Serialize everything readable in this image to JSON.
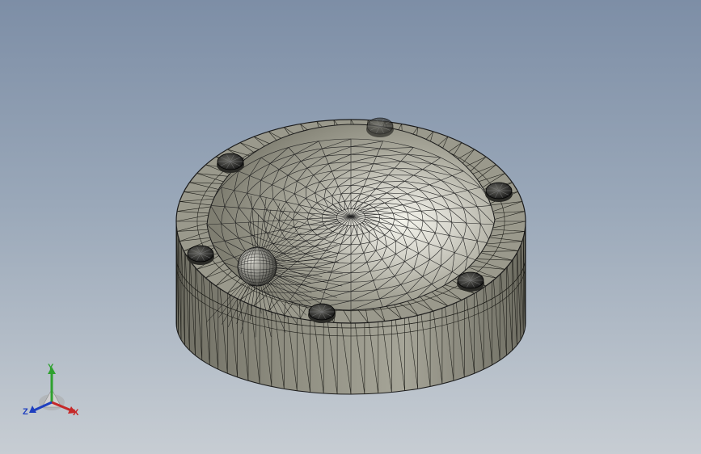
{
  "triad": {
    "x_label": "X",
    "y_label": "Y",
    "z_label": "Z"
  },
  "colors": {
    "background_top": "#7d8ea6",
    "background_bottom": "#c7cdd3",
    "part_face": "#8d8c7f",
    "part_highlight": "#f2f2ea",
    "mesh_edges": "#1a1a1a",
    "axis_x": "#c62828",
    "axis_y": "#2fa12f",
    "axis_z": "#1e3fbf"
  },
  "icons": [
    "view-triad-icon",
    "mesh-part"
  ]
}
